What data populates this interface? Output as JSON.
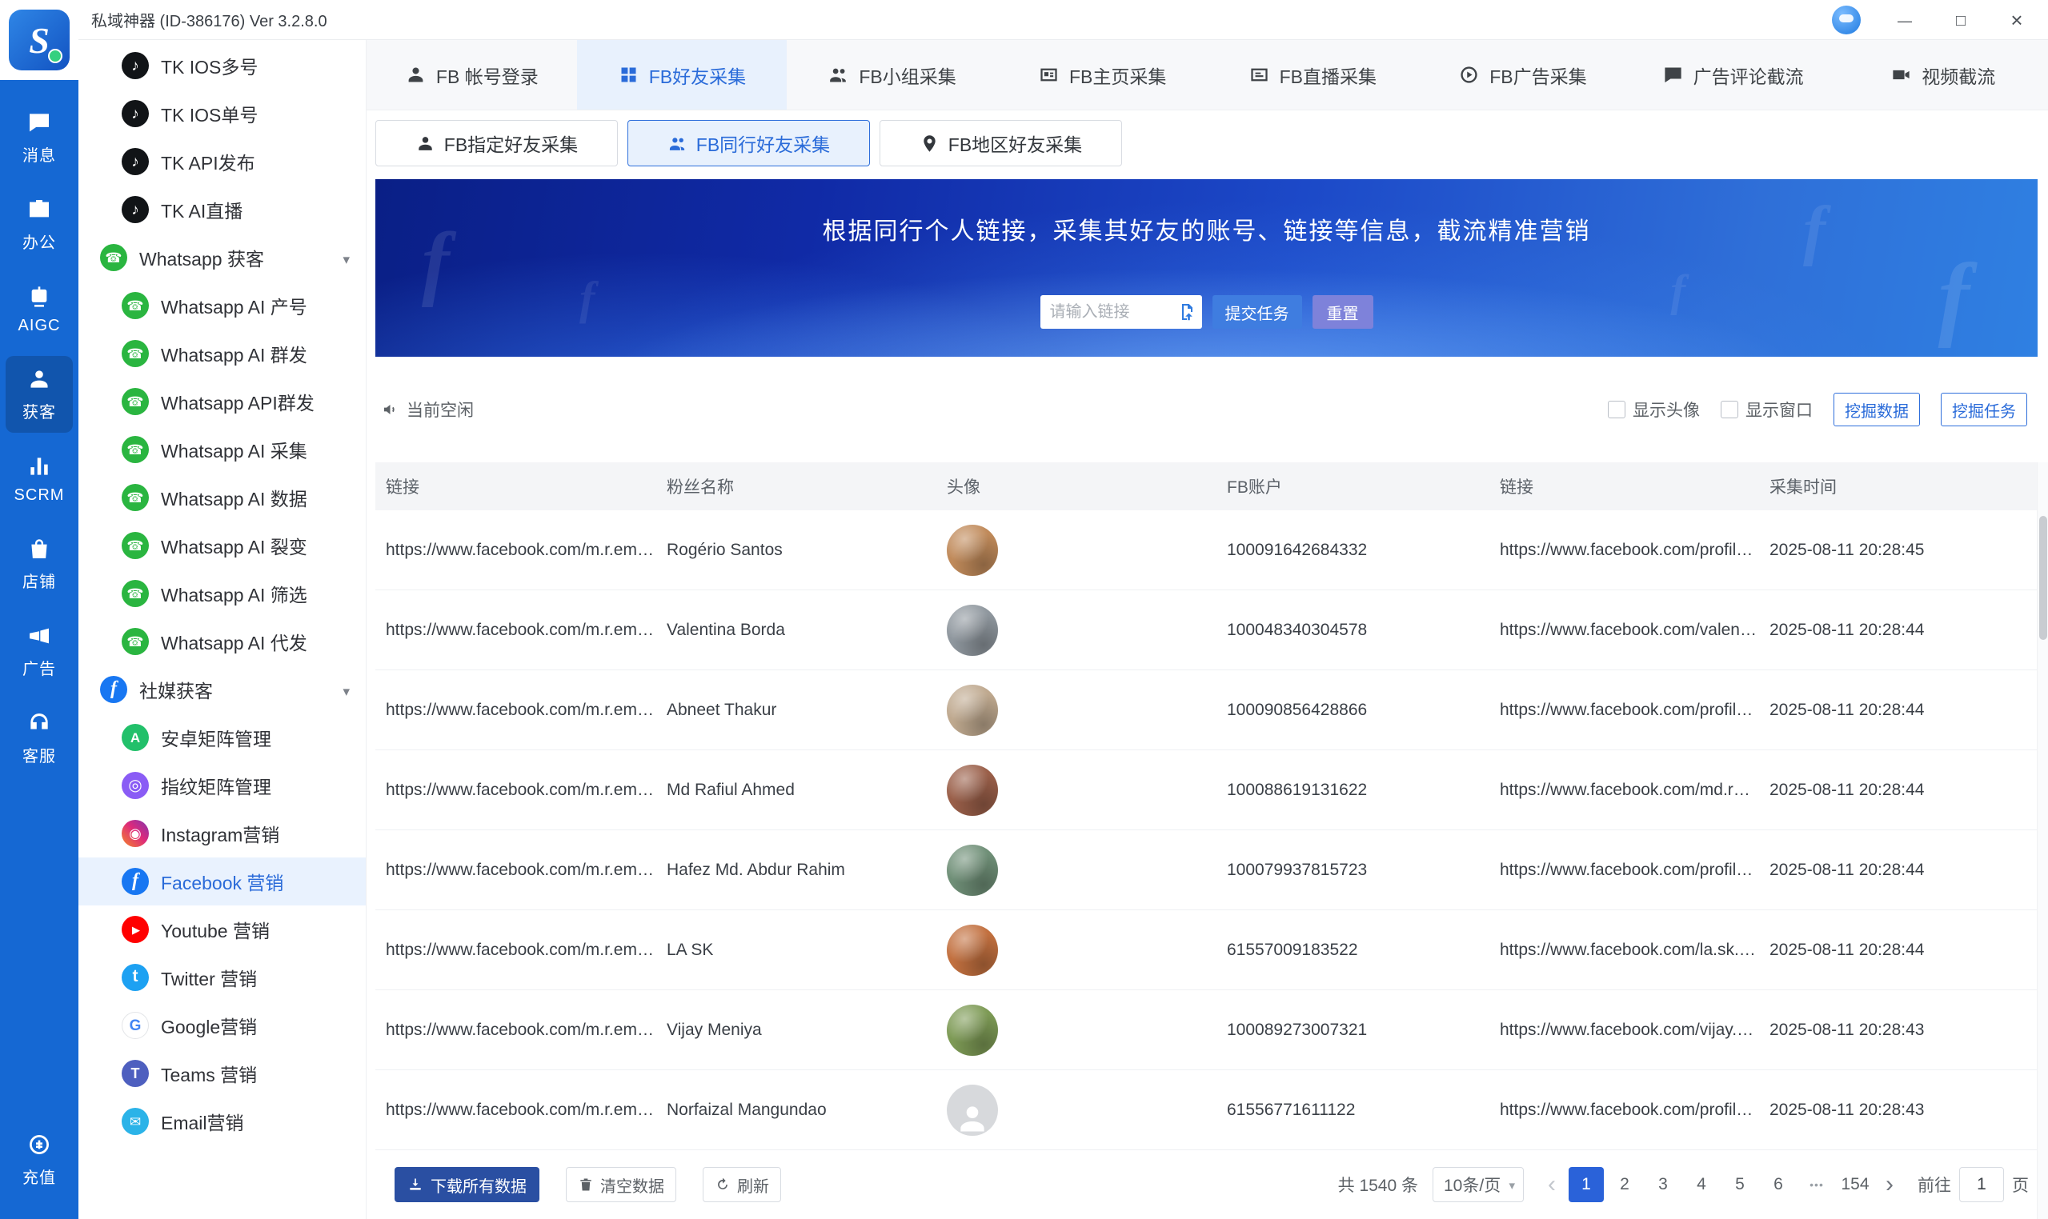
{
  "titlebar": {
    "title": "私域神器 (ID-386176) Ver 3.2.8.0"
  },
  "rail": {
    "items": [
      {
        "label": "消息",
        "icon": "message-icon"
      },
      {
        "label": "办公",
        "icon": "office-icon"
      },
      {
        "label": "AIGC",
        "icon": "aigc-icon"
      },
      {
        "label": "获客",
        "icon": "acquire-icon",
        "state": "active"
      },
      {
        "label": "SCRM",
        "icon": "scrm-icon"
      },
      {
        "label": "店铺",
        "icon": "shop-icon"
      },
      {
        "label": "广告",
        "icon": "ad-icon"
      },
      {
        "label": "客服",
        "icon": "service-icon"
      },
      {
        "label": "充值",
        "icon": "recharge-icon",
        "state": "bottom"
      }
    ]
  },
  "sidebar": {
    "items": [
      {
        "label": "TK IOS多号",
        "icon": "tiktok-icon",
        "level": "child"
      },
      {
        "label": "TK IOS单号",
        "icon": "tiktok-icon",
        "level": "child"
      },
      {
        "label": "TK API发布",
        "icon": "tiktok-icon",
        "level": "child"
      },
      {
        "label": "TK AI直播",
        "icon": "tiktok-icon",
        "level": "child"
      },
      {
        "label": "Whatsapp 获客",
        "icon": "whatsapp-icon",
        "level": "group"
      },
      {
        "label": "Whatsapp AI 产号",
        "icon": "whatsapp-icon",
        "level": "child"
      },
      {
        "label": "Whatsapp AI 群发",
        "icon": "whatsapp-icon",
        "level": "child"
      },
      {
        "label": "Whatsapp API群发",
        "icon": "whatsapp-icon",
        "level": "child"
      },
      {
        "label": "Whatsapp AI 采集",
        "icon": "whatsapp-icon",
        "level": "child"
      },
      {
        "label": "Whatsapp AI 数据",
        "icon": "whatsapp-icon",
        "level": "child"
      },
      {
        "label": "Whatsapp AI 裂变",
        "icon": "whatsapp-icon",
        "level": "child"
      },
      {
        "label": "Whatsapp AI 筛选",
        "icon": "whatsapp-icon",
        "level": "child"
      },
      {
        "label": "Whatsapp AI 代发",
        "icon": "whatsapp-icon",
        "level": "child"
      },
      {
        "label": "社媒获客",
        "icon": "facebook-icon",
        "level": "group"
      },
      {
        "label": "安卓矩阵管理",
        "icon": "android-icon",
        "level": "child"
      },
      {
        "label": "指纹矩阵管理",
        "icon": "fingerprint-icon",
        "level": "child"
      },
      {
        "label": "Instagram营销",
        "icon": "instagram-icon",
        "level": "child"
      },
      {
        "label": "Facebook 营销",
        "icon": "facebook-icon",
        "level": "child",
        "state": "active"
      },
      {
        "label": "Youtube 营销",
        "icon": "youtube-icon",
        "level": "child"
      },
      {
        "label": "Twitter 营销",
        "icon": "twitter-icon",
        "level": "child"
      },
      {
        "label": "Google营销",
        "icon": "google-icon",
        "level": "child"
      },
      {
        "label": "Teams 营销",
        "icon": "teams-icon",
        "level": "child"
      },
      {
        "label": "Email营销",
        "icon": "email-icon",
        "level": "child"
      }
    ]
  },
  "tabs": {
    "items": [
      {
        "label": "FB 帐号登录",
        "icon": "account-icon"
      },
      {
        "label": "FB好友采集",
        "icon": "friend-collect-icon",
        "state": "active"
      },
      {
        "label": "FB小组采集",
        "icon": "group-collect-icon"
      },
      {
        "label": "FB主页采集",
        "icon": "page-collect-icon"
      },
      {
        "label": "FB直播采集",
        "icon": "live-collect-icon"
      },
      {
        "label": "FB广告采集",
        "icon": "ad-collect-icon"
      },
      {
        "label": "广告评论截流",
        "icon": "comment-intercept-icon"
      },
      {
        "label": "视频截流",
        "icon": "video-intercept-icon"
      }
    ]
  },
  "subtabs": {
    "items": [
      {
        "label": "FB指定好友采集",
        "icon": "assigned-friend-icon"
      },
      {
        "label": "FB同行好友采集",
        "icon": "peer-friend-icon",
        "state": "active"
      },
      {
        "label": "FB地区好友采集",
        "icon": "region-friend-icon"
      }
    ]
  },
  "banner": {
    "title": "根据同行个人链接，采集其好友的账号、链接等信息，截流精准营销",
    "input_placeholder": "请输入链接",
    "submit_label": "提交任务",
    "reset_label": "重置"
  },
  "toolbar": {
    "status": "当前空闲",
    "show_avatar_label": "显示头像",
    "show_window_label": "显示窗口",
    "mine_data_label": "挖掘数据",
    "mine_task_label": "挖掘任务"
  },
  "table": {
    "columns": [
      "链接",
      "粉丝名称",
      "头像",
      "FB账户",
      "链接",
      "采集时间"
    ],
    "rows": [
      {
        "source_link": "https://www.facebook.com/m.r.emo...",
        "name": "Rogério Santos",
        "avatar_kind": "photo",
        "avatar_color": "#c08a5a",
        "account": "100091642684332",
        "profile_link": "https://www.facebook.com/profile.p...",
        "time": "2025-08-11 20:28:45"
      },
      {
        "source_link": "https://www.facebook.com/m.r.emo...",
        "name": "Valentina Borda",
        "avatar_kind": "photo",
        "avatar_color": "#8f979e",
        "account": "100048340304578",
        "profile_link": "https://www.facebook.com/valentin...",
        "time": "2025-08-11 20:28:44"
      },
      {
        "source_link": "https://www.facebook.com/m.r.emo...",
        "name": "Abneet Thakur",
        "avatar_kind": "photo",
        "avatar_color": "#bfa98f",
        "account": "100090856428866",
        "profile_link": "https://www.facebook.com/profile.p...",
        "time": "2025-08-11 20:28:44"
      },
      {
        "source_link": "https://www.facebook.com/m.r.emo...",
        "name": "Md Rafiul Ahmed",
        "avatar_kind": "photo",
        "avatar_color": "#9a5f49",
        "account": "100088619131622",
        "profile_link": "https://www.facebook.com/md.rafiu...",
        "time": "2025-08-11 20:28:44"
      },
      {
        "source_link": "https://www.facebook.com/m.r.emo...",
        "name": "Hafez Md. Abdur Rahim",
        "avatar_kind": "photo",
        "avatar_color": "#6f8f77",
        "account": "100079937815723",
        "profile_link": "https://www.facebook.com/profile.p...",
        "time": "2025-08-11 20:28:44"
      },
      {
        "source_link": "https://www.facebook.com/m.r.emo...",
        "name": "LA SK",
        "avatar_kind": "photo",
        "avatar_color": "#c2703f",
        "account": "61557009183522",
        "profile_link": "https://www.facebook.com/la.sk.80...",
        "time": "2025-08-11 20:28:44"
      },
      {
        "source_link": "https://www.facebook.com/m.r.emo...",
        "name": "Vijay Meniya",
        "avatar_kind": "photo",
        "avatar_color": "#7d9a55",
        "account": "100089273007321",
        "profile_link": "https://www.facebook.com/vijay.me...",
        "time": "2025-08-11 20:28:43"
      },
      {
        "source_link": "https://www.facebook.com/m.r.emo...",
        "name": "Norfaizal Mangundao",
        "avatar_kind": "default",
        "avatar_color": "#d7d9dc",
        "account": "61556771611122",
        "profile_link": "https://www.facebook.com/profile.p...",
        "time": "2025-08-11 20:28:43"
      }
    ]
  },
  "footer": {
    "download_label": "下载所有数据",
    "clear_label": "清空数据",
    "refresh_label": "刷新",
    "total": "共 1540 条",
    "page_size": "10条/页",
    "pages": [
      {
        "label": "1",
        "state": "active"
      },
      {
        "label": "2"
      },
      {
        "label": "3"
      },
      {
        "label": "4"
      },
      {
        "label": "5"
      },
      {
        "label": "6"
      },
      {
        "label": "•••",
        "state": "ellipsis"
      },
      {
        "label": "154"
      }
    ],
    "goto_prefix": "前往",
    "goto_value": "1",
    "goto_suffix": "页"
  }
}
